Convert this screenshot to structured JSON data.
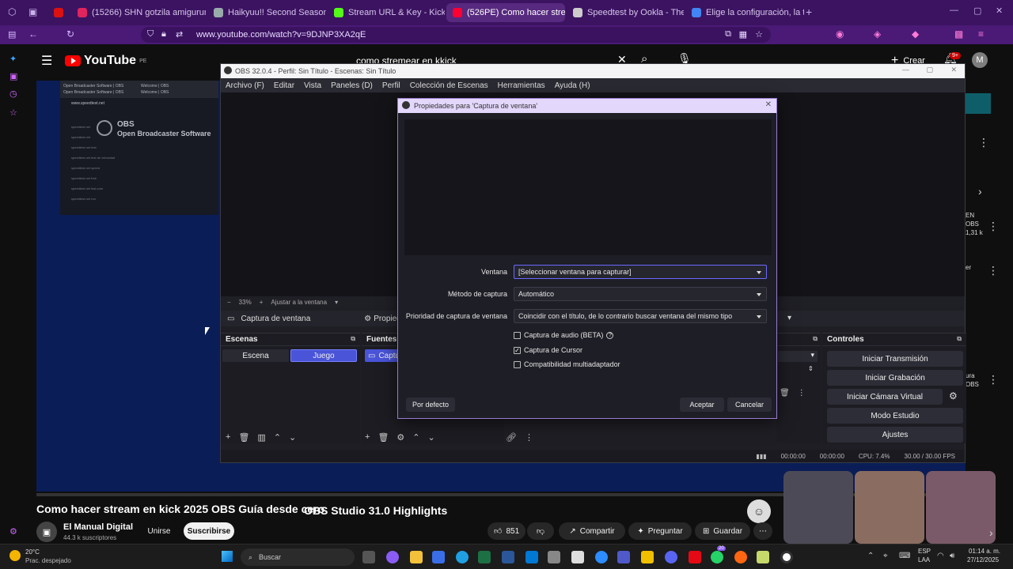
{
  "browser": {
    "tabs": [
      {
        "label": "",
        "x": 0
      },
      {
        "label": "(15266) SHN gotzila amigurumi",
        "x": 0
      },
      {
        "label": "Haikyuu!! Second Season Episo",
        "x": 0
      },
      {
        "label": "Stream URL & Key - Kick Dashb",
        "x": 0
      },
      {
        "label": "(526PE) Como hacer stream",
        "x": 0
      },
      {
        "label": "Speedtest by Ookla - The Glob",
        "x": 0
      },
      {
        "label": "Elige la configuración, la tasa d",
        "x": 0
      }
    ],
    "url": "www.youtube.com/watch?v=9DJNP3XA2qE"
  },
  "youtube": {
    "logo": "YouTube",
    "region": "PE",
    "search_value": "como stremear en kkick",
    "create_label": "Crear",
    "notif_count": "9+",
    "account_initial": "M",
    "side_labels": [
      "EN",
      "OBS",
      "1,31 k",
      "er",
      "ura",
      "OBS"
    ],
    "video_overlay_title": "OBS Studio 31.0 Highlights",
    "video_title": "Como hacer stream en kick 2025 OBS Guía desde cero",
    "channel_name": "El Manual Digital",
    "subscribers": "44.3 k suscriptores",
    "join_label": "Unirse",
    "subscribe_label": "Suscribirse",
    "likes": "851",
    "share_label": "Compartir",
    "ask_label": "Preguntar",
    "save_label": "Guardar"
  },
  "thumb_window": {
    "tab1": "Open Broadcaster Software | OBS",
    "tab2": "Open Broadcaster Software | OBS",
    "tab3": "Welcome | OBS",
    "tab4": "Welcome | OBS",
    "url": "www.speedtest.net",
    "obs_line1": "OBS",
    "obs_line2": "Open Broadcaster Software",
    "items": [
      "speedtest.net",
      "speedtest.net",
      "speedtest.net test",
      "speedtest.net test de velocidad",
      "speedtest.net speed",
      "speedtest.net free",
      "speedtest.net fast.com",
      "speedtest.net run"
    ]
  },
  "obs": {
    "title": "OBS 32.0.4 - Perfil: Sin Título - Escenas: Sin Título",
    "menu": [
      "Archivo (F)",
      "Editar",
      "Vista",
      "Paneles (D)",
      "Perfil",
      "Colección de Escenas",
      "Herramientas",
      "Ayuda (H)"
    ],
    "zoom": "33%",
    "fit_label": "Ajustar a la ventana",
    "source_name": "Captura de ventana",
    "properties_label": "Propiedades",
    "scenes_title": "Escenas",
    "scenes": [
      "Escena",
      "Juego"
    ],
    "sources_title": "Fuentes",
    "source_item": "Captu",
    "controls_title": "Controles",
    "controls": [
      "Iniciar Transmisión",
      "Iniciar Grabación",
      "Iniciar Cámara Virtual",
      "Modo Estudio",
      "Ajustes"
    ],
    "status": {
      "rec_time": "00:00:00",
      "stream_time": "00:00:00",
      "cpu": "CPU: 7.4%",
      "fps": "30.00 / 30.00 FPS"
    }
  },
  "props": {
    "title": "Propiedades para 'Captura de ventana'",
    "window_label": "Ventana",
    "window_value": "[Seleccionar ventana para capturar]",
    "method_label": "Método de captura",
    "method_value": "Automático",
    "priority_label": "Prioridad de captura de ventana",
    "priority_value": "Coincidir con el título, de lo contrario buscar ventana del mismo tipo",
    "audio_label": "Captura de audio (BETA)",
    "audio_checked": false,
    "cursor_label": "Captura de Cursor",
    "cursor_checked": true,
    "multi_label": "Compatibilidad multiadaptador",
    "multi_checked": false,
    "default_btn": "Por defecto",
    "ok_btn": "Aceptar",
    "cancel_btn": "Cancelar"
  },
  "taskbar": {
    "weather_temp": "20°C",
    "weather_desc": "Prac. despejado",
    "search_placeholder": "Buscar",
    "lang": "ESP",
    "lang2": "LAA",
    "time": "01:14 a. m.",
    "date": "27/12/2025",
    "badge": "20"
  }
}
